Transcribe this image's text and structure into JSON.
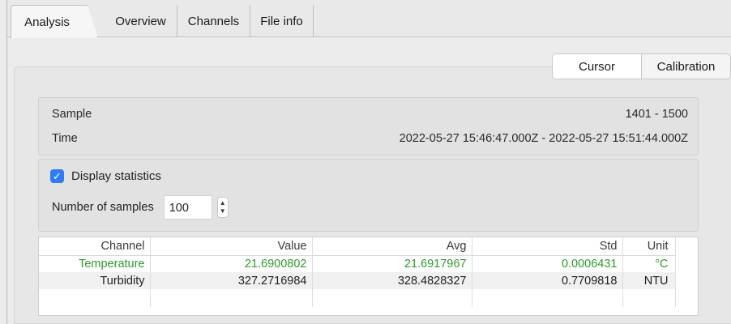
{
  "tabs": [
    {
      "label": "Analysis",
      "active": true
    },
    {
      "label": "Overview",
      "active": false
    },
    {
      "label": "Channels",
      "active": false
    },
    {
      "label": "File info",
      "active": false
    }
  ],
  "view_mode": {
    "options": [
      "Cursor",
      "Calibration"
    ],
    "selected": "Cursor"
  },
  "info": {
    "sample_label": "Sample",
    "sample_value": "1401 - 1500",
    "time_label": "Time",
    "time_value": "2022-05-27 15:46:47.000Z - 2022-05-27 15:51:44.000Z"
  },
  "statistics": {
    "display_label": "Display statistics",
    "display_checked": true,
    "num_samples_label": "Number of samples",
    "num_samples_value": "100"
  },
  "table": {
    "headers": {
      "channel": "Channel",
      "value": "Value",
      "avg": "Avg",
      "std": "Std",
      "unit": "Unit"
    },
    "rows": [
      {
        "channel": "Temperature",
        "value": "21.6900802",
        "avg": "21.6917967",
        "std": "0.0006431",
        "unit": "°C",
        "color": "#2e9a2e"
      },
      {
        "channel": "Turbidity",
        "value": "327.2716984",
        "avg": "328.4828327",
        "std": "0.7709818",
        "unit": "NTU",
        "color": "#1e1e1e"
      }
    ]
  },
  "colors": {
    "accent": "#2f7cf6",
    "highlight_text": "#2e9a2e"
  }
}
